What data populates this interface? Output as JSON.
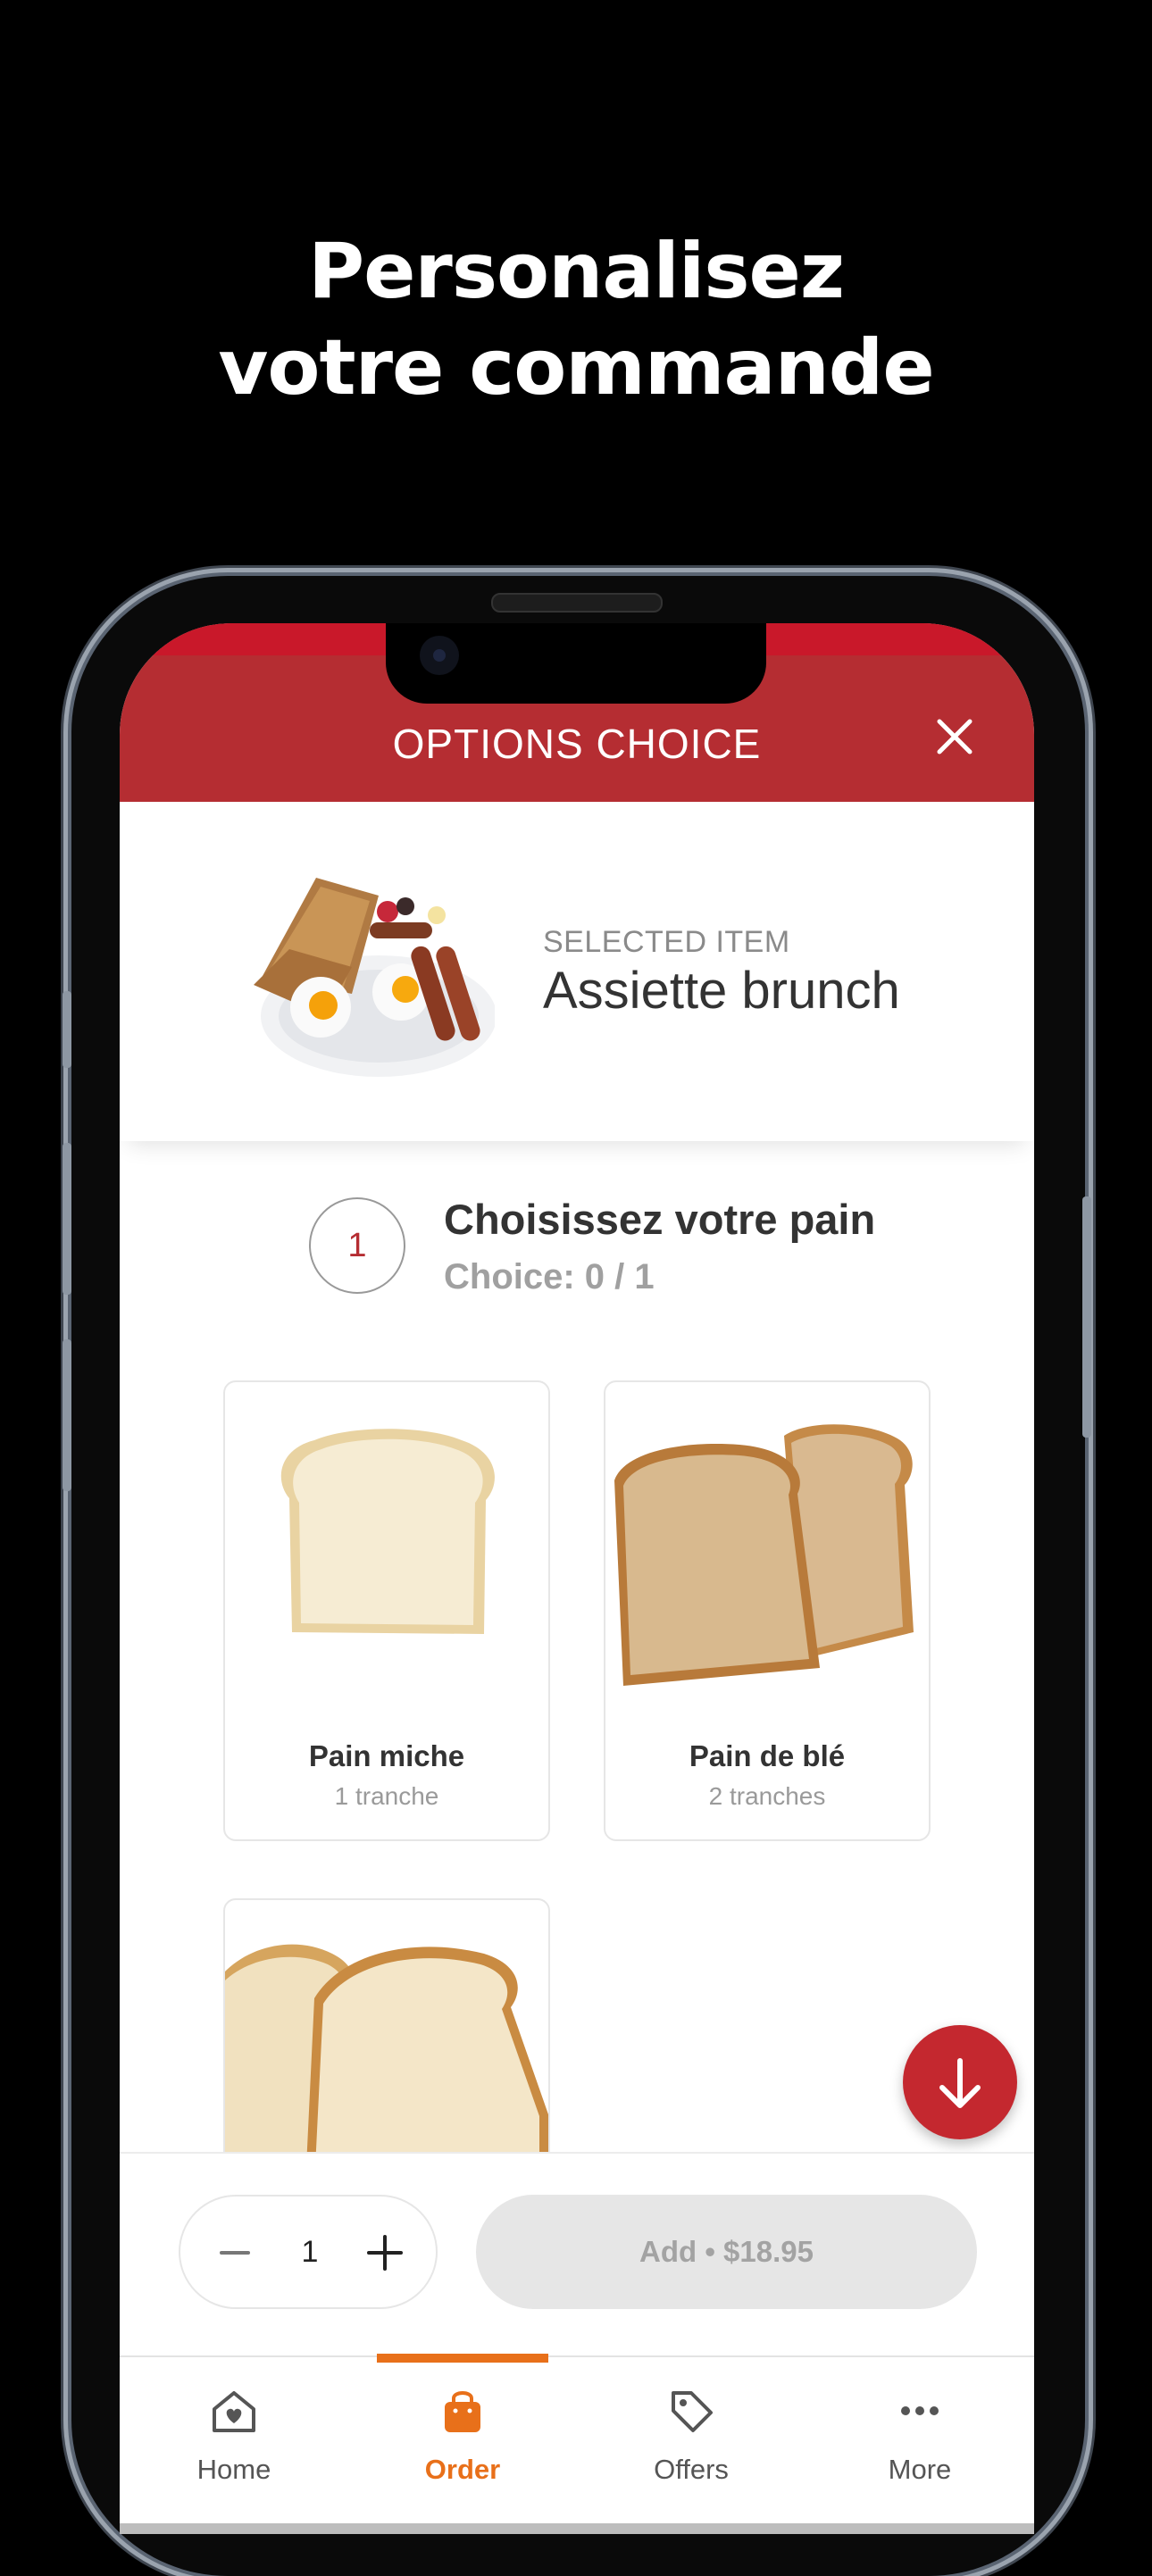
{
  "headline": {
    "line1": "Personalisez",
    "line2": "votre commande"
  },
  "modal": {
    "title": "OPTIONS CHOICE"
  },
  "selected_item": {
    "label": "SELECTED ITEM",
    "name": "Assiette brunch"
  },
  "option_group": {
    "number": "1",
    "title": "Choisissez votre pain",
    "choice": "Choice: 0 / 1"
  },
  "options": [
    {
      "name": "Pain miche",
      "detail": "1 tranche"
    },
    {
      "name": "Pain de blé",
      "detail": "2 tranches"
    },
    {
      "name": "",
      "detail": ""
    }
  ],
  "quantity": {
    "value": "1"
  },
  "add_button": {
    "label": "Add • $18.95"
  },
  "tabs": [
    {
      "label": "Home",
      "icon": "home-heart-icon"
    },
    {
      "label": "Order",
      "icon": "shopping-bag-icon"
    },
    {
      "label": "Offers",
      "icon": "tag-icon"
    },
    {
      "label": "More",
      "icon": "more-dots-icon"
    }
  ],
  "colors": {
    "brand_red": "#b52d32",
    "active_tab": "#e8701a",
    "background": "#000000"
  }
}
